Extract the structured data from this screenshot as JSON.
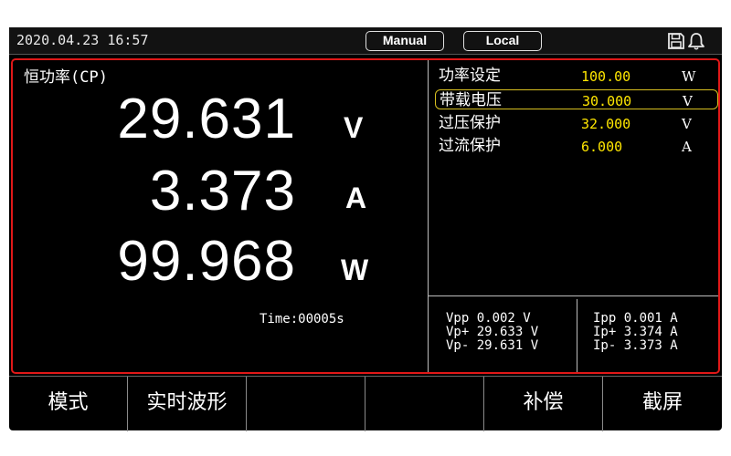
{
  "status_bar": {
    "datetime": "2020.04.23 16:57",
    "control_mode": "Manual",
    "remote_state": "Local",
    "icons": [
      "save-icon",
      "bell-icon"
    ]
  },
  "mode": {
    "label": "恒功率(CP)"
  },
  "readings": {
    "voltage": {
      "value": "29.631",
      "unit": "V"
    },
    "current": {
      "value": "3.373",
      "unit": "A"
    },
    "power": {
      "value": "99.968",
      "unit": "W"
    }
  },
  "timer": "Time:00005s",
  "settings": [
    {
      "label": "功率设定",
      "value": "100.00",
      "unit": "W"
    },
    {
      "label": "带载电压",
      "value": "30.000",
      "unit": "V"
    },
    {
      "label": "过压保护",
      "value": "32.000",
      "unit": "V"
    },
    {
      "label": "过流保护",
      "value": "6.000",
      "unit": "A"
    }
  ],
  "peaks": {
    "voltage": "Vpp 0.002 V\nVp+ 29.633 V\nVp- 29.631 V",
    "current": "Ipp 0.001 A\nIp+ 3.374 A\nIp- 3.373 A"
  },
  "softkeys": [
    "模式",
    "实时波形",
    "",
    "",
    "补偿",
    "截屏"
  ],
  "colors": {
    "highlight": "#ffe600",
    "border": "#e01818",
    "background": "#000000"
  }
}
